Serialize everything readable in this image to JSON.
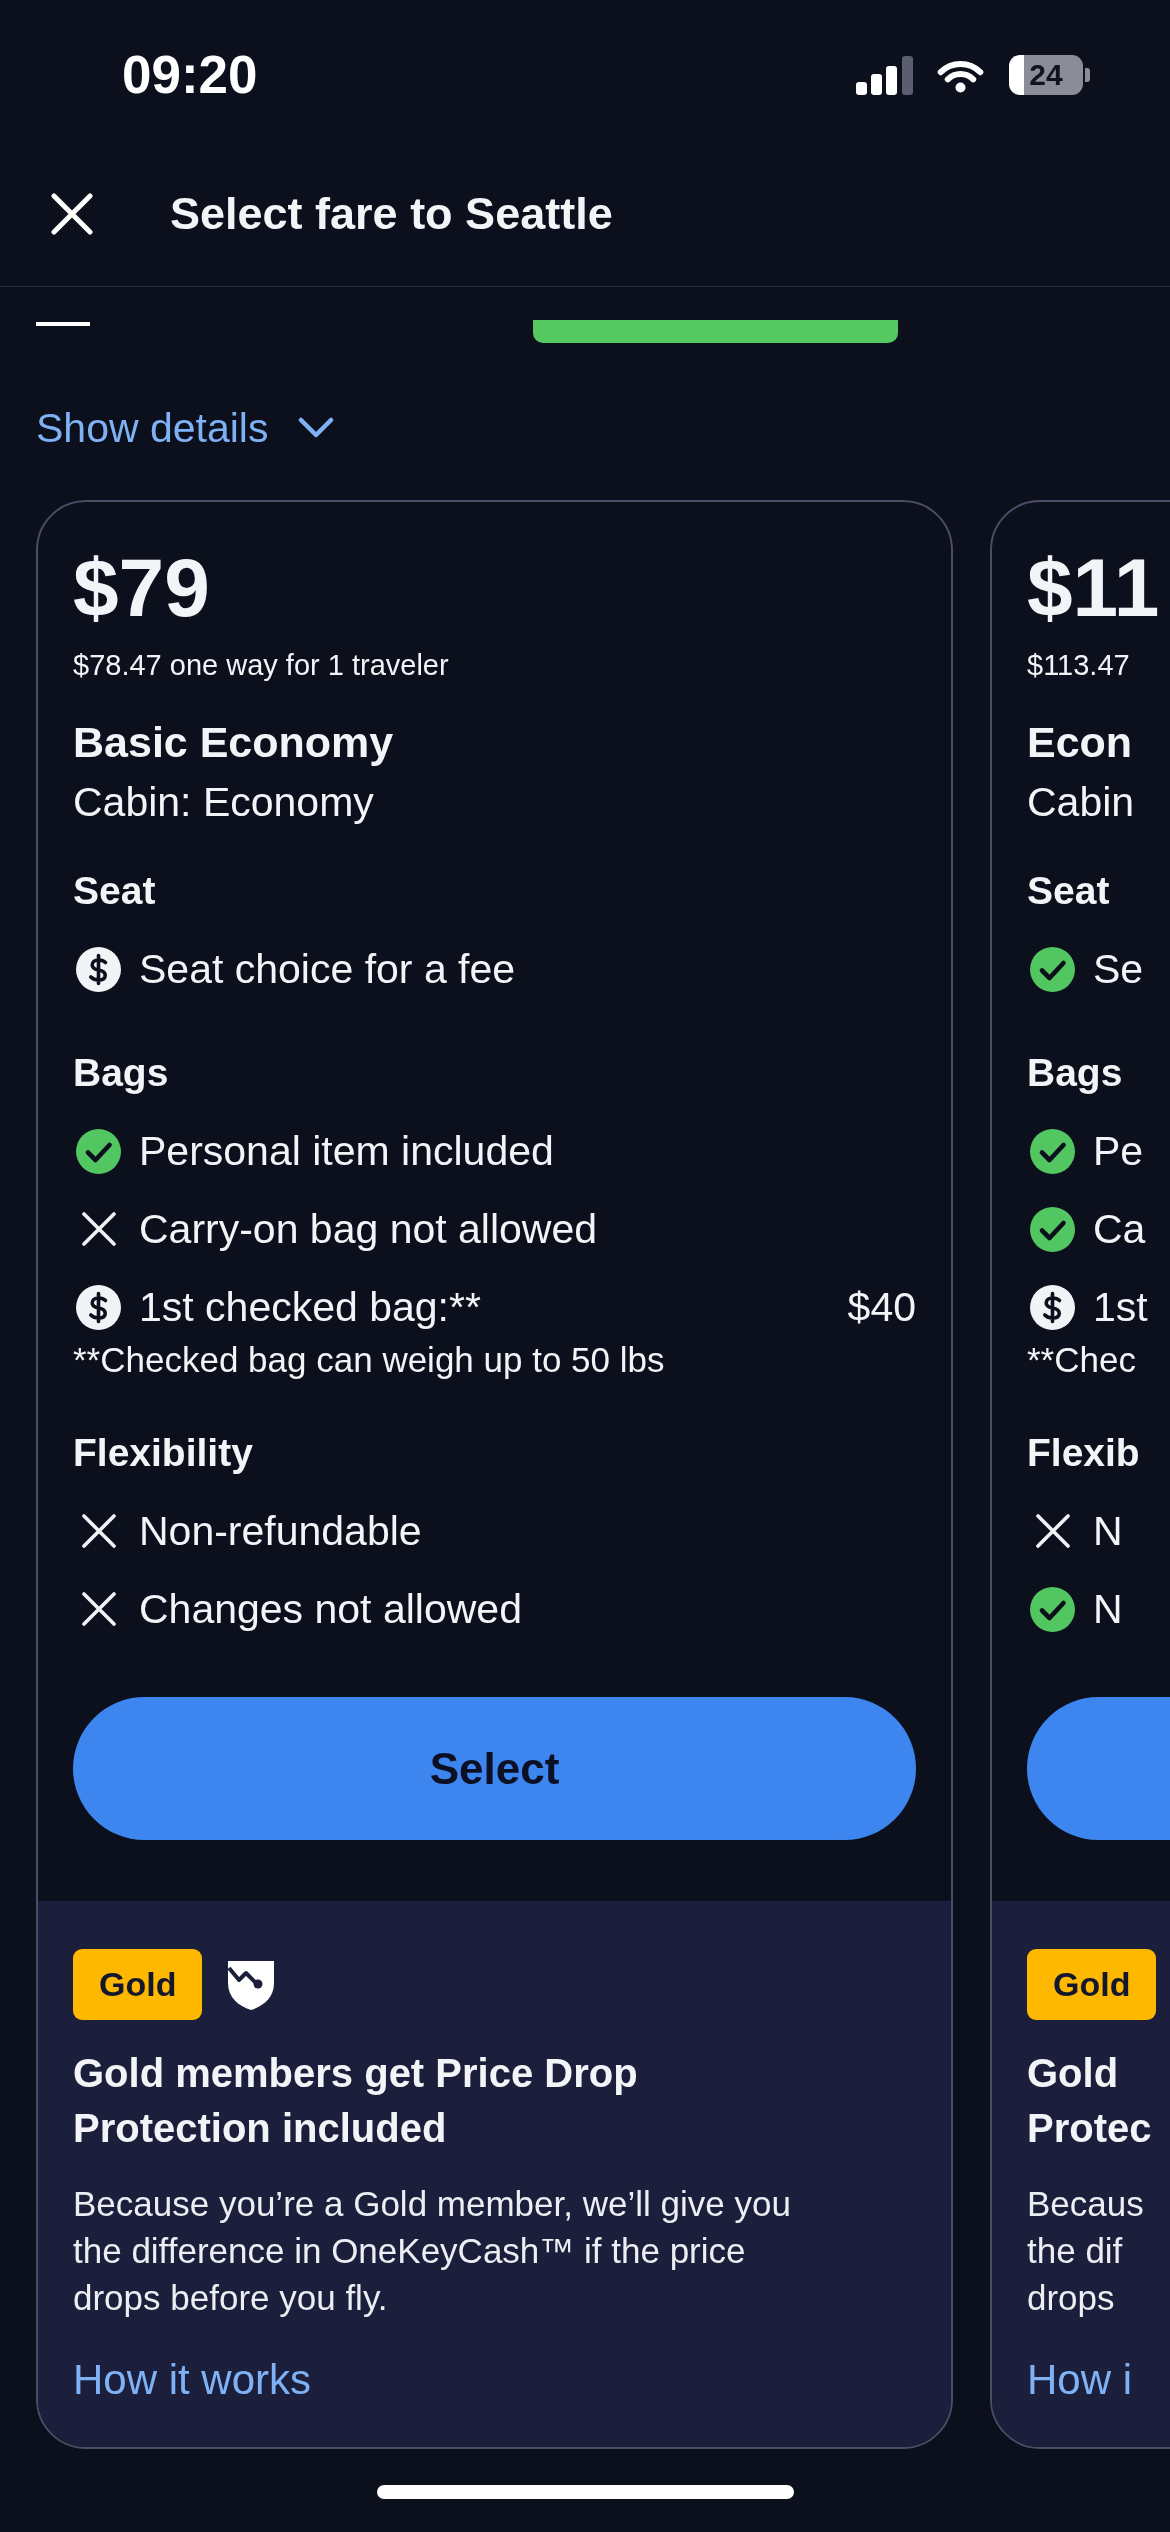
{
  "status_bar": {
    "time": "09:20",
    "battery": "24"
  },
  "header": {
    "title": "Select fare to Seattle"
  },
  "show_details": "Show details",
  "fares": [
    {
      "price": "$79",
      "price_detail": "$78.47 one way for 1 traveler",
      "name": "Basic Economy",
      "cabin": "Cabin: Economy",
      "sections": [
        {
          "title": "Seat",
          "features": [
            {
              "kind": "fee",
              "text": "Seat choice for a fee"
            }
          ]
        },
        {
          "title": "Bags",
          "features": [
            {
              "kind": "included",
              "text": "Personal item included"
            },
            {
              "kind": "excluded",
              "text": "Carry-on bag not allowed"
            },
            {
              "kind": "fee",
              "text": "1st checked bag:**",
              "price": "$40"
            }
          ],
          "note": "**Checked bag can weigh up to 50 lbs"
        },
        {
          "title": "Flexibility",
          "features": [
            {
              "kind": "excluded",
              "text": "Non-refundable"
            },
            {
              "kind": "excluded",
              "text": "Changes not allowed"
            }
          ]
        }
      ],
      "button": "Select",
      "promo": {
        "badge": "Gold",
        "title_lines": [
          "Gold members get Price Drop",
          "Protection included"
        ],
        "text_lines": [
          "Because you’re a Gold member, we’ll give you",
          "the difference in OneKeyCash™ if the price",
          "drops before you fly."
        ],
        "link": "How it works"
      }
    },
    {
      "price": "$11",
      "price_detail": "$113.47",
      "name": "Econ",
      "cabin": "Cabin",
      "sections": [
        {
          "title": "Seat",
          "features": [
            {
              "kind": "included",
              "text": "Se"
            }
          ]
        },
        {
          "title": "Bags",
          "features": [
            {
              "kind": "included",
              "text": "Pe"
            },
            {
              "kind": "included",
              "text": "Ca"
            },
            {
              "kind": "fee",
              "text": "1st"
            }
          ],
          "note": "**Chec"
        },
        {
          "title": "Flexib",
          "features": [
            {
              "kind": "excluded",
              "text": "N"
            },
            {
              "kind": "included",
              "text": "N"
            }
          ]
        }
      ],
      "promo": {
        "badge": "Gold",
        "title_lines": [
          "Gold",
          "Protec"
        ],
        "text_lines": [
          "Becaus",
          "the dif",
          "drops"
        ],
        "link": "How i"
      }
    }
  ]
}
